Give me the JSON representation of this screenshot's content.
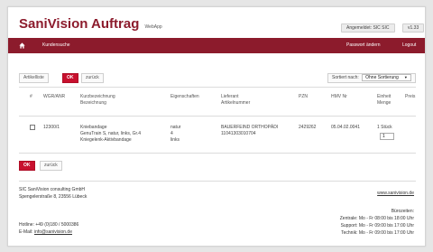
{
  "header": {
    "brand_part1": "SaniVision",
    "brand_part2": "Auftrag",
    "brand_suffix": "WebApp",
    "user_badge": "Angemeldet: SIC SIC",
    "version_badge": "v1.33"
  },
  "nav": {
    "home_icon": "home-icon",
    "customer_search": "Kundensuche",
    "change_password": "Passwort ändern",
    "logout": "Logout"
  },
  "toolbar": {
    "article_list": "Artikelliste",
    "ok": "OK",
    "back": "zurück",
    "sort_label": "Sortiert nach:",
    "sort_value": "Ohne Sortierung"
  },
  "table": {
    "headers": {
      "number": "#",
      "wgr": "WGR/ANR",
      "short_desc_line1": "Kurzbezeichnung",
      "short_desc_line2": "Bezeichnung",
      "properties": "Eigenschaften",
      "supplier_line1": "Lieferant",
      "supplier_line2": "Artikelnummer",
      "pzn": "PZN",
      "hmv": "HMV Nr",
      "unit_line1": "Einheit",
      "unit_line2": "Menge",
      "price": "Preis"
    },
    "rows": [
      {
        "wgr": "12300/1",
        "desc_line1": "Kniebandage",
        "desc_line2": "GenuTrain S, natur, links, Gr.4",
        "desc_line3": "Kniegelenk-Aktivbandage",
        "prop_line1": "natur",
        "prop_line2": "4",
        "prop_line3": "links",
        "supplier": "BAUERFEIND ORTHOPÄDI",
        "supplier_article": "11041303010704",
        "pzn": "2429262",
        "hmv": "05.04.02.0041",
        "unit": "1 Stück",
        "quantity": "1"
      }
    ]
  },
  "bottom": {
    "ok": "OK",
    "back": "zurück"
  },
  "footer": {
    "company": "SIC SaniVision consulting GmbH",
    "address": "Spengelerstraße 8, 23556 Lübeck",
    "website": "www.sanivision.de",
    "hotline": "Hotline: +49 (0)180 / 5000386",
    "email_label": "E-Mail:",
    "email": "info@sanivision.de",
    "hours_title": "Bürozeiten:",
    "hours_central": "Zentrale: Mo - Fr 08:00 bis 18:00 Uhr",
    "hours_support": "Support: Mo - Fr 09:00 bis 17:00 Uhr",
    "hours_tech": "Technik: Mo - Fr 09:00 bis 17:00 Uhr"
  },
  "colors": {
    "brand": "#8c1b2c",
    "ok_button": "#c8102e"
  }
}
